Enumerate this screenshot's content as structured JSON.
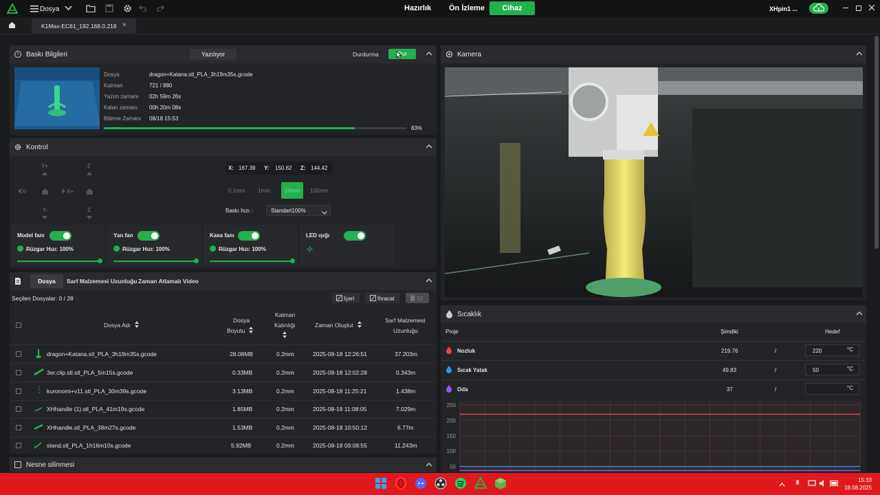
{
  "topbar": {
    "menu_label": "Dosya",
    "nav": {
      "prepare": "Hazırlık",
      "preview": "Ön İzleme",
      "device": "Cihaz"
    },
    "user": "XHpin1 ..."
  },
  "tab": {
    "label": "K1Max-EC61_192.168.0.218",
    "close": "×"
  },
  "print_info": {
    "title": "Baskı Bilgileri",
    "status": "Yazılıyor",
    "pause": "Durdurma",
    "stop": "Dur",
    "labels": {
      "file": "Dosya",
      "layer": "Katman",
      "print_time": "Yazım zamanı",
      "remaining": "Kalan zamanı",
      "finish": "Bitirme Zamanı"
    },
    "values": {
      "file": "dragon+Katana.stl_PLA_3h19m35s.gcode",
      "layer": "721 / 880",
      "print_time": "02h 59m 26s",
      "remaining": "00h 20m 08s",
      "finish": "08/18 15:53"
    },
    "progress_text": "83%",
    "progress": 0.83
  },
  "control": {
    "title": "Kontrol",
    "jog": {
      "y_plus": "Y+",
      "y_minus": "Y-",
      "x_minus": "X-",
      "x_plus": "X+",
      "z_up": "Z",
      "z_down": "Z"
    },
    "coords": {
      "x_label": "X:",
      "x": "167.39",
      "y_label": "Y:",
      "y": "150.62",
      "z_label": "Z:",
      "z": "144.42"
    },
    "steps": [
      "0.1mm",
      "1mm",
      "10mm",
      "100mm"
    ],
    "active_step": 2,
    "speed_label": "Baskı hızı :",
    "speed_value": "Standart100%",
    "fans": [
      {
        "label": "Model fanı",
        "speed": "Rüzgar Hızı: 100%",
        "level": 1.0
      },
      {
        "label": "Yan fan",
        "speed": "Rüzgar Hızı: 100%",
        "level": 1.0
      },
      {
        "label": "Kasa fanı",
        "speed": "Rüzgar Hızı: 100%",
        "level": 1.0
      }
    ],
    "led_label": "LED ışığı"
  },
  "files": {
    "tabs": [
      "Dosya",
      "Sarf Malzemesi Uzunluğu",
      "Zaman Atlamalı Video"
    ],
    "selected": "Seçilen Dosyalar: 0 / 28",
    "import": "İçeri",
    "export": "İhracat",
    "delete": "Sil",
    "headers": {
      "name": "Dosya Adı",
      "size": [
        "Dosya",
        "Boyutu"
      ],
      "layer": [
        "Katman",
        "Kalınlığı"
      ],
      "time": "Zaman Oluştur",
      "filament": [
        "Sarf Malzemesi",
        "Uzunluğu"
      ]
    },
    "rows": [
      {
        "name": "dragon+Katana.stl_PLA_3h19m35s.gcode",
        "size": "28.08MB",
        "layer": "0.2mm",
        "time": "2025-08-18 12:26:51",
        "filament": "37.203m"
      },
      {
        "name": "3er.clip.stl.stl_PLA_5m15s.gcode",
        "size": "0.33MB",
        "layer": "0.2mm",
        "time": "2025-08-18 12:02:28",
        "filament": "0.343m"
      },
      {
        "name": "kuronomi+v11.stl_PLA_30m39s.gcode",
        "size": "3.13MB",
        "layer": "0.2mm",
        "time": "2025-08-18 11:25:21",
        "filament": "1.438m"
      },
      {
        "name": "XHhandle (1).stl_PLA_41m19s.gcode",
        "size": "1.85MB",
        "layer": "0.2mm",
        "time": "2025-08-18 11:08:05",
        "filament": "7.029m"
      },
      {
        "name": "XHhandle.stl_PLA_38m27s.gcode",
        "size": "1.53MB",
        "layer": "0.2mm",
        "time": "2025-08-18 10:50:12",
        "filament": "6.77m"
      },
      {
        "name": "stand.stl_PLA_1h16m10s.gcode",
        "size": "5.92MB",
        "layer": "0.2mm",
        "time": "2025-08-18 09:08:55",
        "filament": "11.243m"
      }
    ],
    "bottom_title": "Nesne silinmesi"
  },
  "camera": {
    "title": "Kamera"
  },
  "temperature": {
    "title": "Sıcaklık",
    "headers": {
      "item": "Proje",
      "current": "Şimdiki",
      "target": "Hedef"
    },
    "rows": [
      {
        "name": "Nozluk",
        "current": "219.76",
        "sep": "/",
        "target": "220",
        "unit": "°C",
        "color": "#e0454b"
      },
      {
        "name": "Sıcak Yatak",
        "current": "49.83",
        "sep": "/",
        "target": "50",
        "unit": "°C",
        "color": "#3a8fe0"
      },
      {
        "name": "Oda",
        "current": "37",
        "sep": "/",
        "target": "",
        "unit": "°C",
        "color": "#9b59e6"
      }
    ],
    "chart_data": {
      "type": "line",
      "yticks": [
        "250",
        "200",
        "150",
        "100",
        "50"
      ],
      "ylim": [
        0,
        250
      ],
      "series": [
        {
          "color": "#d84a55",
          "values": [
            220,
            220,
            220,
            220,
            220,
            220,
            220,
            220,
            220,
            220
          ]
        },
        {
          "color": "#3a8fe0",
          "values": [
            50,
            50,
            50,
            50,
            50,
            50,
            50,
            50,
            50,
            50
          ]
        },
        {
          "color": "#9b59e6",
          "values": [
            37,
            37,
            37,
            37,
            37,
            37,
            37,
            37,
            37,
            37
          ]
        }
      ],
      "grid": true
    }
  },
  "taskbar": {
    "time": "15:33",
    "date": "18.08.2025"
  }
}
